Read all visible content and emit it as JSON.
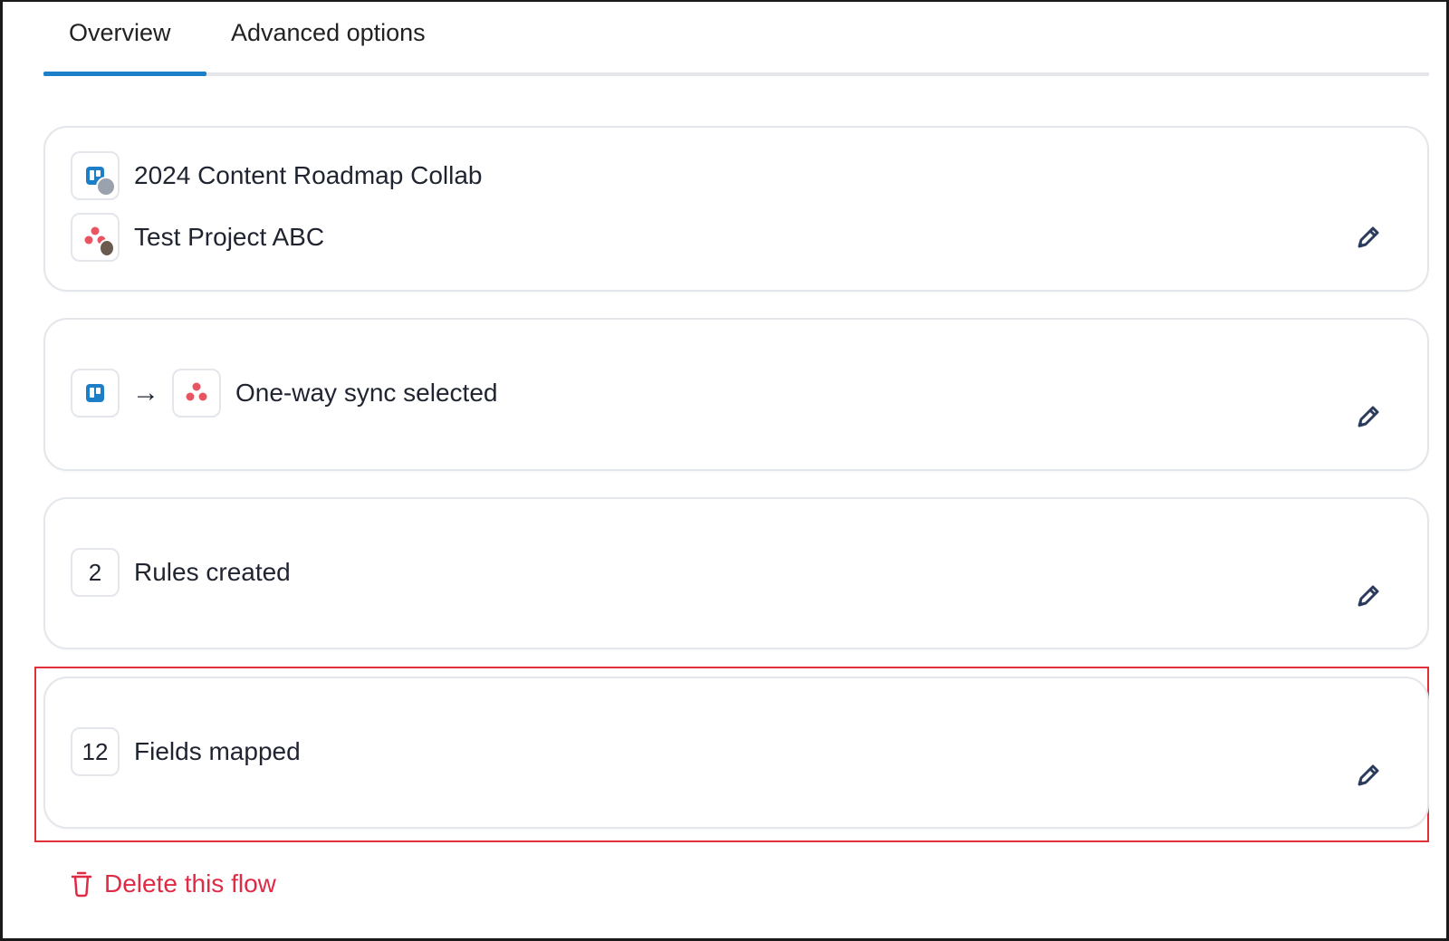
{
  "tabs": [
    {
      "label": "Overview",
      "active": true
    },
    {
      "label": "Advanced options",
      "active": false
    }
  ],
  "projects": {
    "trello_board": "2024 Content Roadmap Collab",
    "asana_project": "Test Project ABC"
  },
  "sync": {
    "direction_label": "One-way sync selected",
    "arrow": "→"
  },
  "rules": {
    "count": "2",
    "label": "Rules created"
  },
  "fields": {
    "count": "12",
    "label": "Fields mapped"
  },
  "delete_label": "Delete this flow",
  "colors": {
    "accent": "#1e7fc9",
    "trello": "#1e7fc9",
    "asana": "#e85561",
    "danger": "#e02b46",
    "highlight": "#e0303c",
    "edit_icon": "#2a3b5c"
  },
  "icons": {
    "edit": "pencil-icon",
    "delete": "trash-icon",
    "trello": "trello-icon",
    "asana": "asana-icon"
  }
}
